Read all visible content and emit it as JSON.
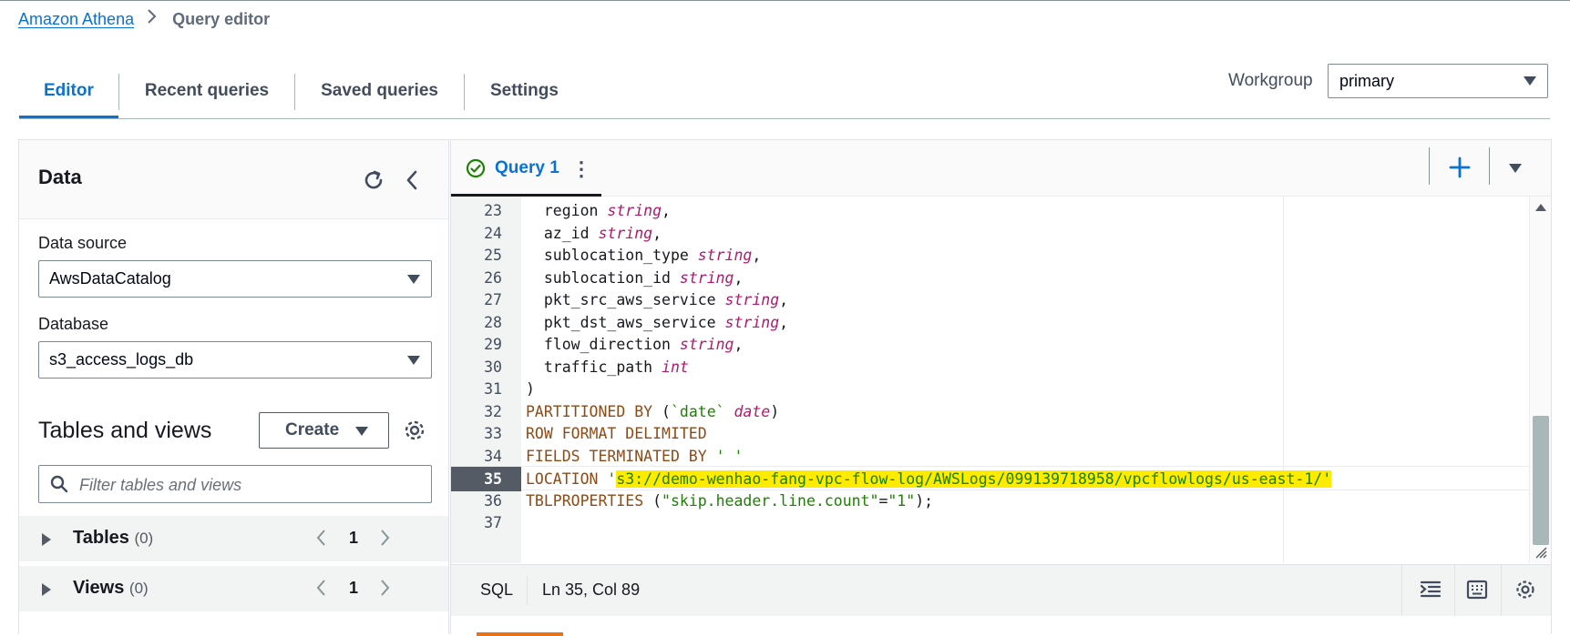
{
  "breadcrumb": {
    "link": "Amazon Athena",
    "current": "Query editor"
  },
  "tabs": [
    {
      "label": "Editor"
    },
    {
      "label": "Recent queries"
    },
    {
      "label": "Saved queries"
    },
    {
      "label": "Settings"
    }
  ],
  "workgroup": {
    "label": "Workgroup",
    "value": "primary"
  },
  "left_panel": {
    "title": "Data",
    "data_source_label": "Data source",
    "data_source_value": "AwsDataCatalog",
    "database_label": "Database",
    "database_value": "s3_access_logs_db",
    "tables_views_title": "Tables and views",
    "create_label": "Create",
    "filter_placeholder": "Filter tables and views",
    "tables": {
      "label": "Tables",
      "count": "(0)",
      "page": "1"
    },
    "views": {
      "label": "Views",
      "count": "(0)",
      "page": "1"
    }
  },
  "editor": {
    "query_tab": "Query 1",
    "kebab": "⋮",
    "lines": [
      {
        "num": "23",
        "parts": [
          {
            "t": "  region ",
            "c": ""
          },
          {
            "t": "string",
            "c": "ty"
          },
          {
            "t": ",",
            "c": ""
          }
        ]
      },
      {
        "num": "24",
        "parts": [
          {
            "t": "  az_id ",
            "c": ""
          },
          {
            "t": "string",
            "c": "ty"
          },
          {
            "t": ",",
            "c": ""
          }
        ]
      },
      {
        "num": "25",
        "parts": [
          {
            "t": "  sublocation_type ",
            "c": ""
          },
          {
            "t": "string",
            "c": "ty"
          },
          {
            "t": ",",
            "c": ""
          }
        ]
      },
      {
        "num": "26",
        "parts": [
          {
            "t": "  sublocation_id ",
            "c": ""
          },
          {
            "t": "string",
            "c": "ty"
          },
          {
            "t": ",",
            "c": ""
          }
        ]
      },
      {
        "num": "27",
        "parts": [
          {
            "t": "  pkt_src_aws_service ",
            "c": ""
          },
          {
            "t": "string",
            "c": "ty"
          },
          {
            "t": ",",
            "c": ""
          }
        ]
      },
      {
        "num": "28",
        "parts": [
          {
            "t": "  pkt_dst_aws_service ",
            "c": ""
          },
          {
            "t": "string",
            "c": "ty"
          },
          {
            "t": ",",
            "c": ""
          }
        ]
      },
      {
        "num": "29",
        "parts": [
          {
            "t": "  flow_direction ",
            "c": ""
          },
          {
            "t": "string",
            "c": "ty"
          },
          {
            "t": ",",
            "c": ""
          }
        ]
      },
      {
        "num": "30",
        "parts": [
          {
            "t": "  traffic_path ",
            "c": ""
          },
          {
            "t": "int",
            "c": "ty"
          }
        ]
      },
      {
        "num": "31",
        "parts": [
          {
            "t": ")",
            "c": ""
          }
        ]
      },
      {
        "num": "32",
        "parts": [
          {
            "t": "PARTITIONED BY",
            "c": "kw"
          },
          {
            "t": " (",
            "c": ""
          },
          {
            "t": "`date`",
            "c": "str"
          },
          {
            "t": " ",
            "c": ""
          },
          {
            "t": "date",
            "c": "ty"
          },
          {
            "t": ")",
            "c": ""
          }
        ]
      },
      {
        "num": "33",
        "parts": [
          {
            "t": "ROW FORMAT DELIMITED",
            "c": "kw"
          }
        ]
      },
      {
        "num": "34",
        "parts": [
          {
            "t": "FIELDS TERMINATED BY",
            "c": "kw"
          },
          {
            "t": " ",
            "c": ""
          },
          {
            "t": "' '",
            "c": "str"
          }
        ]
      },
      {
        "num": "35",
        "active": true,
        "parts": [
          {
            "t": "LOCATION",
            "c": "kw"
          },
          {
            "t": " ",
            "c": ""
          },
          {
            "t": "'",
            "c": "str"
          },
          {
            "t": "s3://demo-wenhao-fang-vpc-flow-log/AWSLogs/099139718958/vpcflowlogs/us-east-1/",
            "c": "str hl"
          },
          {
            "t": "'",
            "c": "str hl"
          }
        ]
      },
      {
        "num": "36",
        "parts": [
          {
            "t": "TBLPROPERTIES",
            "c": "kw"
          },
          {
            "t": " (",
            "c": ""
          },
          {
            "t": "\"skip.header.line.count\"",
            "c": "str"
          },
          {
            "t": "=",
            "c": ""
          },
          {
            "t": "\"1\"",
            "c": "str"
          },
          {
            "t": ");",
            "c": ""
          }
        ]
      },
      {
        "num": "37",
        "parts": []
      }
    ],
    "status_lang": "SQL",
    "status_pos": "Ln 35, Col 89"
  },
  "colors": {
    "accent": "#0972d3",
    "success": "#1d8102",
    "highlight": "#ffeb00"
  }
}
